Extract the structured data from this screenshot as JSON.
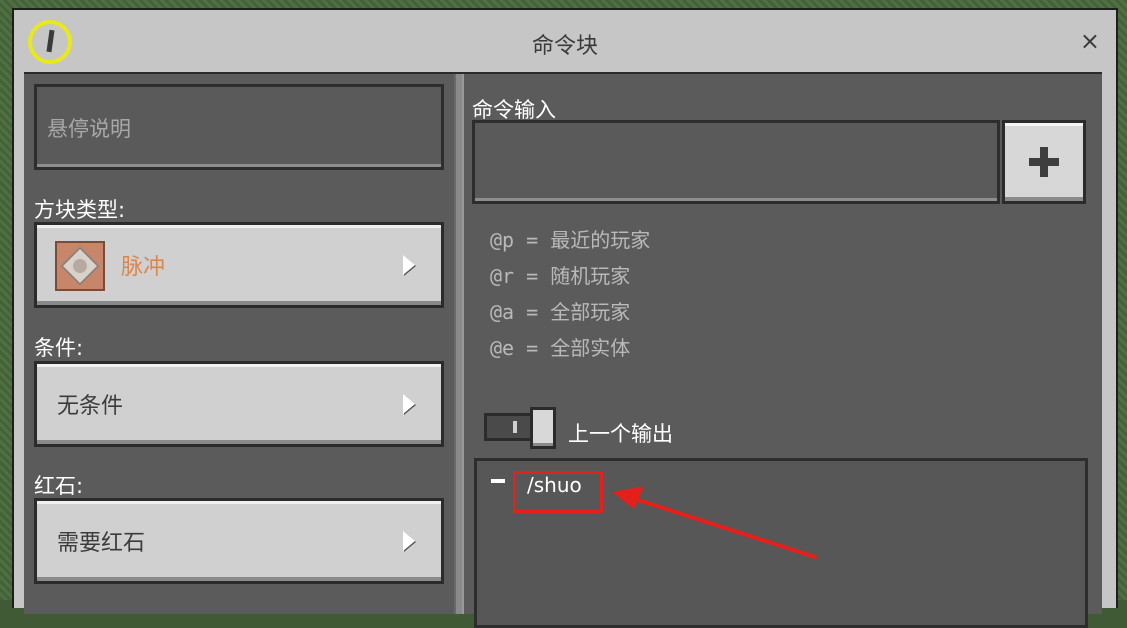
{
  "window": {
    "title": "命令块",
    "close_glyph": "×"
  },
  "left": {
    "hover_note": {
      "placeholder": "悬停说明"
    },
    "block_type": {
      "label": "方块类型:",
      "value": "脉冲",
      "value_color": "#d9874f"
    },
    "condition": {
      "label": "条件:",
      "value": "无条件"
    },
    "redstone": {
      "label": "红石:",
      "value": "需要红石"
    }
  },
  "right": {
    "command_input": {
      "label": "命令输入",
      "value": "",
      "add_button_icon": "plus-icon"
    },
    "selectors": [
      {
        "code": "@p",
        "desc": "最近的玩家"
      },
      {
        "code": "@r",
        "desc": "随机玩家"
      },
      {
        "code": "@a",
        "desc": "全部玩家"
      },
      {
        "code": "@e",
        "desc": "全部实体"
      }
    ],
    "previous_output": {
      "label": "上一个输出",
      "text": "/shuo"
    }
  },
  "annotations": {
    "highlight_color": "#e3201b"
  }
}
